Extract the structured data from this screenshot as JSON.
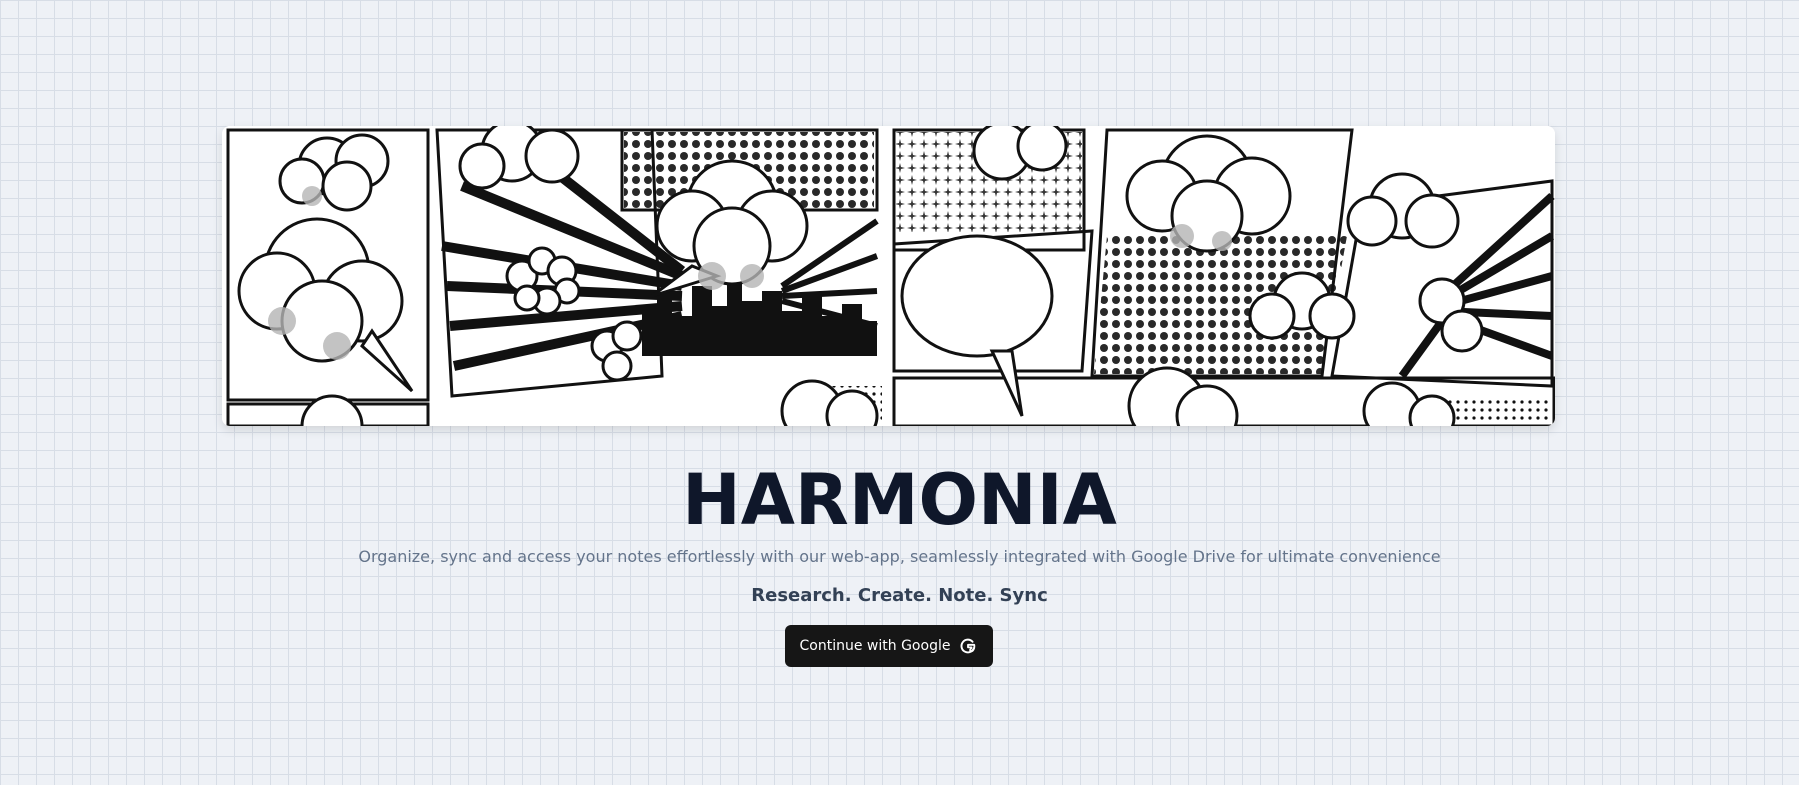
{
  "app": {
    "title": "HARMONIA",
    "subtitle": "Organize, sync and access your notes effortlessly with our web-app, seamlessly integrated with Google Drive for ultimate convenience",
    "tagline": "Research. Create. Note. Sync"
  },
  "auth": {
    "button_label": "Continue with Google",
    "button_icon": "google-g-icon"
  },
  "hero": {
    "image_description_icon": "comic-panel-banner"
  },
  "colors": {
    "background": "#eef1f6",
    "grid": "#d7dde6",
    "title": "#0f172a",
    "subtitle": "#64748b",
    "tagline": "#334155",
    "button_bg": "#161616",
    "button_text": "#ffffff"
  }
}
